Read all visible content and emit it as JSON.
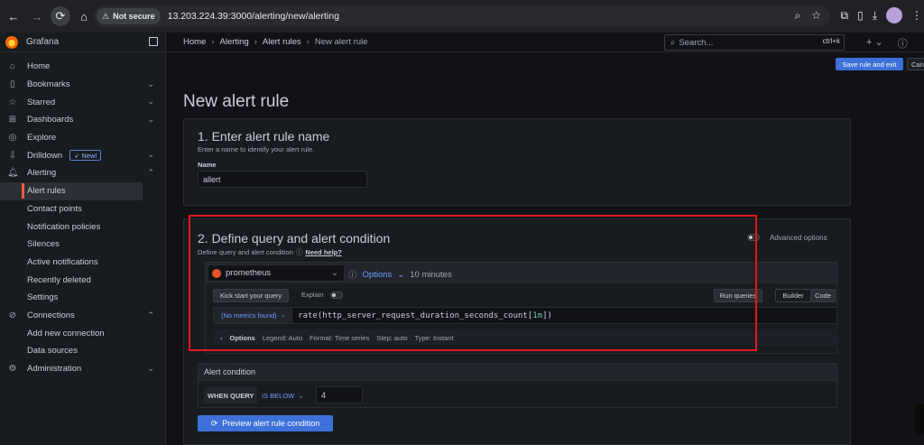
{
  "browser": {
    "security_label": "Not secure",
    "url": "13.203.224.39:3000/alerting/new/alerting"
  },
  "sidebar": {
    "brand": "Grafana",
    "items": [
      {
        "label": "Home",
        "icon": "home-icon",
        "has_chevron": false
      },
      {
        "label": "Bookmarks",
        "icon": "bookmark-icon",
        "has_chevron": true
      },
      {
        "label": "Starred",
        "icon": "star-icon",
        "has_chevron": true
      },
      {
        "label": "Dashboards",
        "icon": "apps-icon",
        "has_chevron": true
      },
      {
        "label": "Explore",
        "icon": "compass-icon",
        "has_chevron": false
      },
      {
        "label": "Drilldown",
        "icon": "drilldown-icon",
        "has_chevron": true,
        "badge": "New!"
      },
      {
        "label": "Alerting",
        "icon": "bell-icon",
        "has_chevron": true
      }
    ],
    "alerting_sub": [
      "Alert rules",
      "Contact points",
      "Notification policies",
      "Silences",
      "Active notifications",
      "Recently deleted",
      "Settings"
    ],
    "connections": {
      "label": "Connections",
      "icon": "connections-icon"
    },
    "connections_sub": [
      "Add new connection",
      "Data sources"
    ],
    "administration": {
      "label": "Administration",
      "icon": "cog-icon"
    }
  },
  "topbar": {
    "breadcrumb": [
      "Home",
      "Alerting",
      "Alert rules",
      "New alert rule"
    ],
    "search_placeholder": "Search...",
    "search_shortcut": "ctrl+k"
  },
  "actions": {
    "save_label": "Save rule and exit",
    "cancel_label": "Can"
  },
  "page_title": "New alert rule",
  "section1": {
    "title": "1. Enter alert rule name",
    "description": "Enter a name to identify your alert rule.",
    "name_label": "Name",
    "name_value": "allert"
  },
  "section2": {
    "title": "2. Define query and alert condition",
    "description": "Define query and alert condition",
    "help_link": "Need help?",
    "advanced_options": "Advanced options",
    "datasource": "prometheus",
    "options_label": "Options",
    "interval": "10 minutes",
    "kick_start": "Kick start your query",
    "explain": "Explain",
    "run_queries": "Run queries",
    "builder": "Builder",
    "code": "Code",
    "metrics_found": "(No metrics found)",
    "query_prefix": "rate(http_server_request_duration_seconds_count[",
    "query_num": "1m",
    "query_suffix": "])",
    "opts_title": "Options",
    "opt_legend": "Legend: Auto",
    "opt_format": "Format: Time series",
    "opt_step": "Step: auto",
    "opt_type": "Type: Instant"
  },
  "condition": {
    "title": "Alert condition",
    "when_query": "WHEN QUERY",
    "operator": "IS BELOW",
    "threshold": "4",
    "preview_label": "Preview alert rule condition"
  },
  "colors": {
    "accent": "#3d71d9",
    "highlight": "#e0191f",
    "link": "#6e9fff"
  }
}
